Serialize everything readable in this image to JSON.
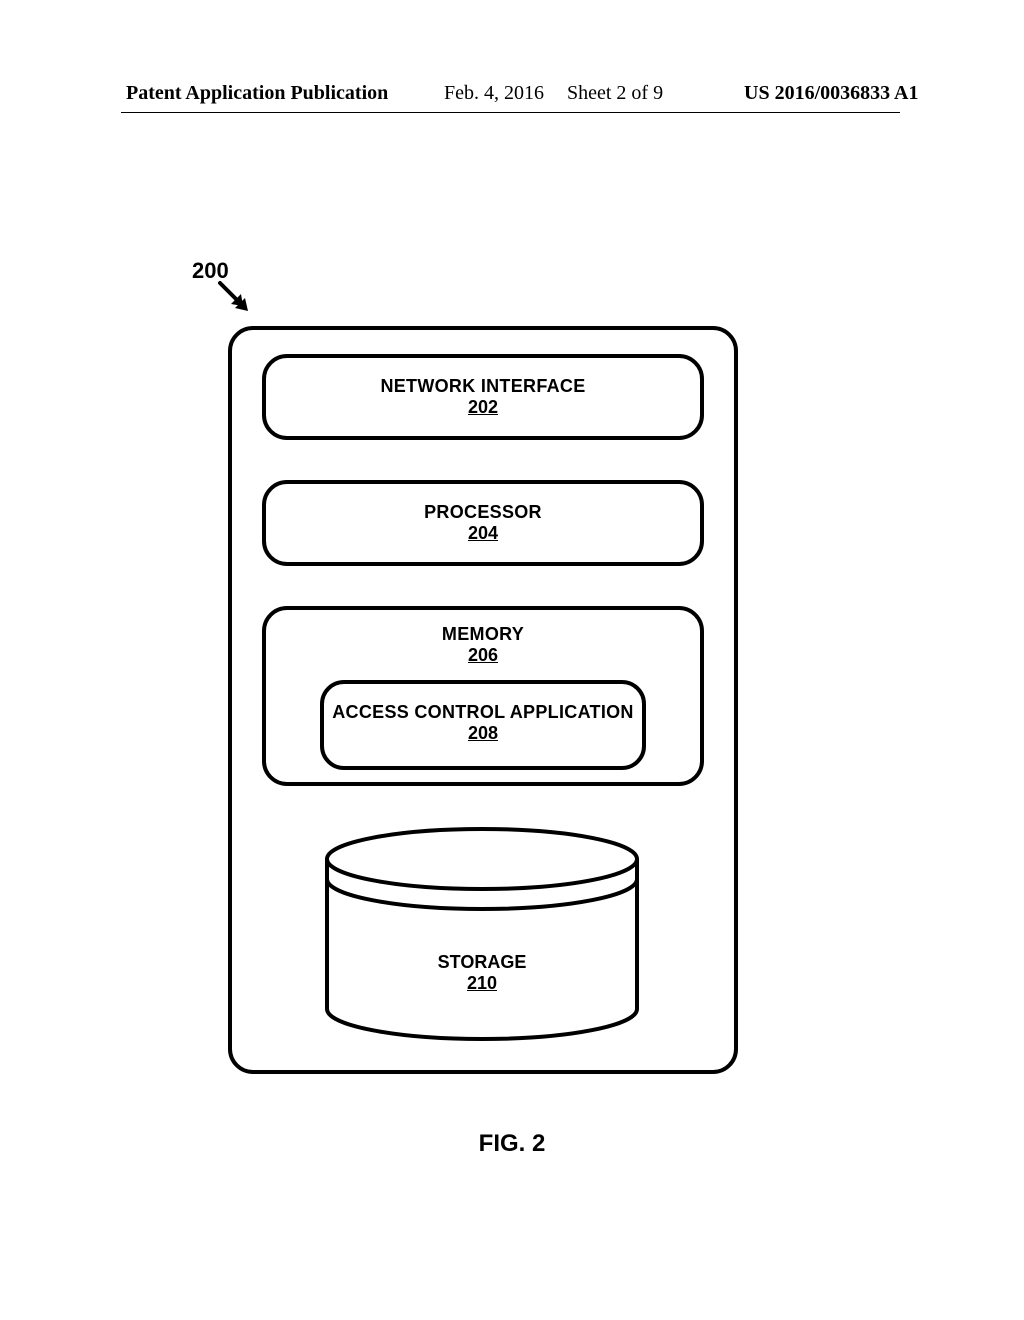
{
  "header": {
    "left": "Patent Application Publication",
    "date": "Feb. 4, 2016",
    "sheet": "Sheet 2 of 9",
    "docnum": "US 2016/0036833 A1"
  },
  "figure": {
    "ref_label": "200",
    "caption": "FIG. 2",
    "components": {
      "network_interface": {
        "title": "NETWORK INTERFACE",
        "num": "202"
      },
      "processor": {
        "title": "PROCESSOR",
        "num": "204"
      },
      "memory": {
        "title": "MEMORY",
        "num": "206"
      },
      "access_control": {
        "title": "ACCESS CONTROL APPLICATION",
        "num": "208"
      },
      "storage": {
        "title": "STORAGE",
        "num": "210"
      }
    }
  }
}
